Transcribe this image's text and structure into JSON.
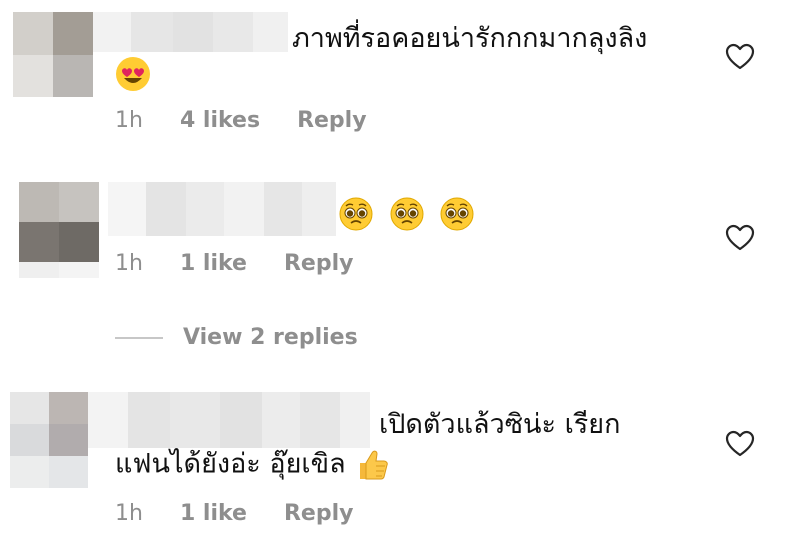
{
  "comments": [
    {
      "text": "ภาพที่รอคอยน่ารักกกมากลุงลิง",
      "emojis": [
        "heart-eyes"
      ],
      "time": "1h",
      "likes": "4 likes",
      "reply": "Reply"
    },
    {
      "text": "",
      "emojis": [
        "pleading",
        "pleading",
        "pleading"
      ],
      "time": "1h",
      "likes": "1 like",
      "reply": "Reply"
    },
    {
      "text_line1": "เปิดตัวแล้วซิน่ะ เรียก",
      "text_line2": "แฟนได้ยังอ่ะ อุ๊ยเขิล",
      "emojis": [
        "thumbs-up"
      ],
      "time": "1h",
      "likes": "1 like",
      "reply": "Reply"
    }
  ],
  "view_replies": "View 2 replies",
  "colors": {
    "meta": "#8e8e8e",
    "text": "#111111",
    "line": "#c7c7c7",
    "heart_stroke": "#262626"
  }
}
